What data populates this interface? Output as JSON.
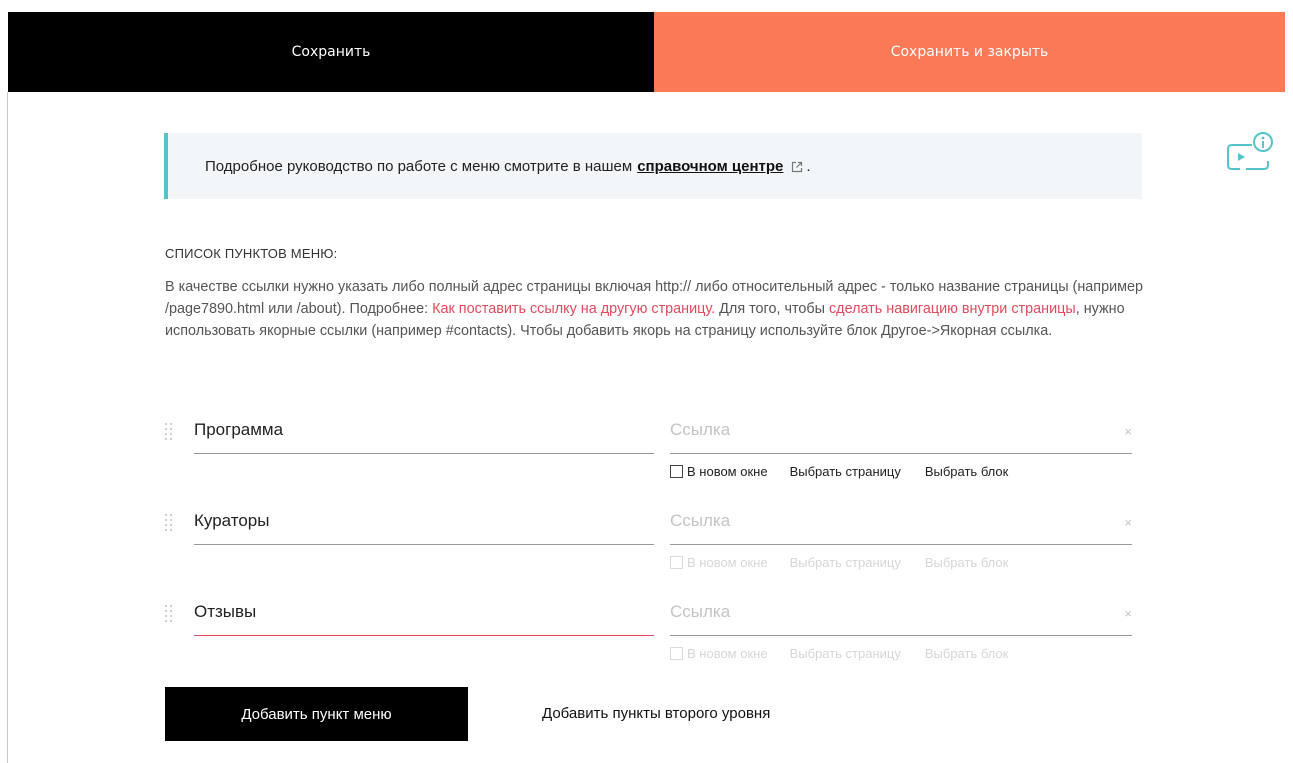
{
  "toolbar": {
    "save_label": "Сохранить",
    "save_close_label": "Сохранить и закрыть",
    "save_close_color": "#fa7a58"
  },
  "help_icon": "video-help-icon",
  "notice": {
    "text": "Подробное руководство по работе с меню смотрите в нашем",
    "link_text": "справочном центре",
    "link_icon": "external-link-icon",
    "suffix": "."
  },
  "section": {
    "title": "СПИСОК ПУНКТОВ МЕНЮ:",
    "desc_1": "В качестве ссылки нужно указать либо полный адрес страницы включая http:// либо относительный адрес - только название страницы (например /page7890.html или /about). Подробнее: ",
    "desc_link_1": "Как поставить ссылку на другую страницу.",
    "desc_2": " Для того, чтобы ",
    "desc_link_2": "сделать навигацию внутри страницы",
    "desc_3": ", нужно использовать якорные ссылки (например #contacts). Чтобы добавить якорь на страницу используйте блок Другое->Якорная ссылка.",
    "link_color": "#e24a5c"
  },
  "menu_items": [
    {
      "name": "Программа",
      "link_value": "",
      "link_placeholder": "Ссылка",
      "clear": "×",
      "new_window": "В новом окне",
      "choose_page": "Выбрать страницу",
      "choose_block": "Выбрать блок",
      "options_active": true
    },
    {
      "name": "Кураторы",
      "link_value": "",
      "link_placeholder": "Ссылка",
      "clear": "×",
      "new_window": "В новом окне",
      "choose_page": "Выбрать страницу",
      "choose_block": "Выбрать блок",
      "options_active": false
    },
    {
      "name": "Отзывы",
      "link_value": "",
      "link_placeholder": "Ссылка",
      "clear": "×",
      "new_window": "В новом окне",
      "choose_page": "Выбрать страницу",
      "choose_block": "Выбрать блок",
      "options_active": false
    }
  ],
  "actions": {
    "add_item": "Добавить пункт меню",
    "add_second_level": "Добавить пункты второго уровня"
  }
}
